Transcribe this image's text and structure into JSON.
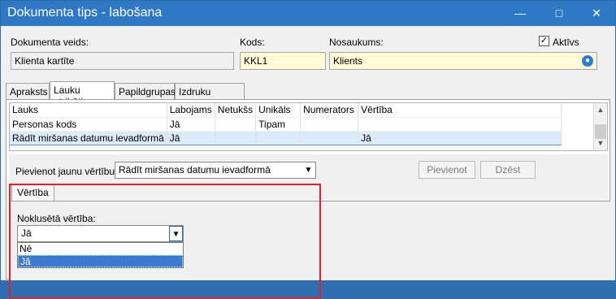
{
  "window": {
    "title": "Dokumenta tips - labošana",
    "minimize": "—",
    "maximize": "□",
    "close": "✕"
  },
  "form": {
    "doc_type_label": "Dokumenta veids:",
    "doc_type_value": "Klienta kartīte",
    "code_label": "Kods:",
    "code_value": "KKL1",
    "name_label": "Nosaukums:",
    "name_value": "Klients",
    "active_label": "Aktīvs",
    "active_checked": true
  },
  "tabs": [
    "Apraksts",
    "Lauku atribūti",
    "Papildgrupas",
    "Izdruku formas"
  ],
  "grid": {
    "columns": [
      "Lauks",
      "Labojams",
      "Netukšs",
      "Unikāls",
      "Numerators",
      "Vērtība"
    ],
    "rows": [
      [
        "Personas kods",
        "Jā",
        "",
        "Tipam",
        "",
        ""
      ],
      [
        "Rādīt miršanas datumu ievadformā",
        "Jā",
        "",
        "",
        "",
        "Jā"
      ]
    ]
  },
  "add_value": {
    "label": "Pievienot jaunu vērtību:",
    "selected": "Rādīt miršanas datumu ievadformā",
    "add_button": "Pievienot",
    "delete_button": "Dzēst"
  },
  "subtab": {
    "label": "Vērtība"
  },
  "default_value": {
    "label": "Noklusētā vērtība:",
    "selected": "Jā",
    "options": [
      "Nē",
      "Jā"
    ]
  }
}
